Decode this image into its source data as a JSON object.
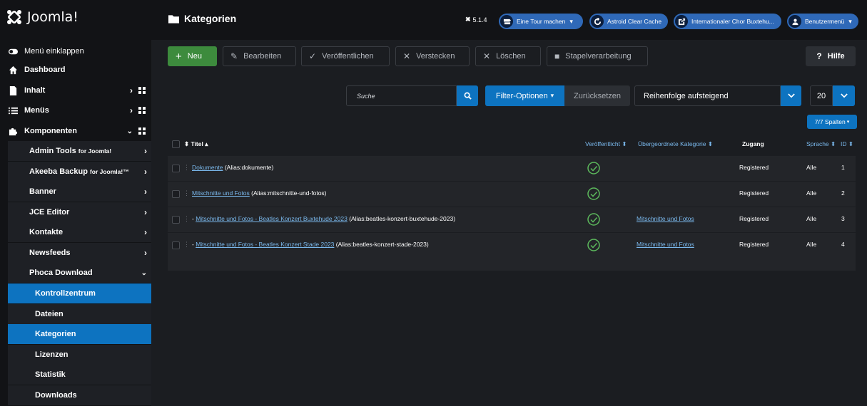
{
  "header": {
    "brand": "Joomla!",
    "page_title": "Kategorien",
    "version": "5.1.4",
    "tour_label": "Eine Tour machen",
    "cache_label": "Astroid Clear Cache",
    "site_label": "Internationaler Chor Buxtehu...",
    "user_label": "Benutzermenü"
  },
  "sidebar": {
    "collapse": "Menü einklappen",
    "dashboard": "Dashboard",
    "content": "Inhalt",
    "menus": "Menüs",
    "components": "Komponenten",
    "components_items": [
      {
        "label": "Admin Tools",
        "suffix": "for Joomla!"
      },
      {
        "label": "Akeeba Backup",
        "suffix": "for Joomla!™"
      },
      {
        "label": "Banner",
        "suffix": ""
      },
      {
        "label": "JCE Editor",
        "suffix": ""
      },
      {
        "label": "Kontakte",
        "suffix": ""
      },
      {
        "label": "Newsfeeds",
        "suffix": ""
      },
      {
        "label": "Phoca Download",
        "suffix": ""
      }
    ],
    "phoca_items": [
      "Kontrollzentrum",
      "Dateien",
      "Kategorien",
      "Lizenzen",
      "Statistik",
      "Downloads"
    ]
  },
  "toolbar": {
    "new": "Neu",
    "edit": "Bearbeiten",
    "publish": "Veröffentlichen",
    "unpublish": "Verstecken",
    "delete": "Löschen",
    "batch": "Stapelverarbeitung",
    "help": "Hilfe"
  },
  "filters": {
    "search_placeholder": "Suche",
    "filter_options": "Filter-Optionen",
    "reset": "Zurücksetzen",
    "ordering": "Reihenfolge aufsteigend",
    "limit": "20",
    "columns": "7/7 Spalten"
  },
  "table": {
    "headers": {
      "title": "Titel",
      "published": "Veröffentlicht",
      "parent": "Übergeordnete Kategorie",
      "access": "Zugang",
      "language": "Sprache",
      "id": "ID"
    },
    "rows": [
      {
        "prefix": "",
        "title": "Dokumente",
        "alias": "(Alias:dokumente)",
        "parent": "",
        "access": "Registered",
        "language": "Alle",
        "id": "1"
      },
      {
        "prefix": "",
        "title": "Mitschnitte und Fotos",
        "alias": "(Alias:mitschnitte-und-fotos)",
        "parent": "",
        "access": "Registered",
        "language": "Alle",
        "id": "2"
      },
      {
        "prefix": "- ",
        "title": "Mitschnitte und Fotos - Beatles Konzert Buxtehude 2023",
        "alias": "(Alias:beatles-konzert-buxtehude-2023)",
        "parent": "Mitschnitte und Fotos",
        "access": "Registered",
        "language": "Alle",
        "id": "3"
      },
      {
        "prefix": "- ",
        "title": "Mitschnitte und Fotos - Beatles Konzert Stade 2023",
        "alias": "(Alias:beatles-konzert-stade-2023)",
        "parent": "Mitschnitte und Fotos",
        "access": "Registered",
        "language": "Alle",
        "id": "4"
      }
    ]
  },
  "colors": {
    "primary": "#0d73c0",
    "success": "#3d8b3d",
    "pill": "#2f69b8",
    "link": "#7ab8ec",
    "published_check": "#5cb85c"
  }
}
